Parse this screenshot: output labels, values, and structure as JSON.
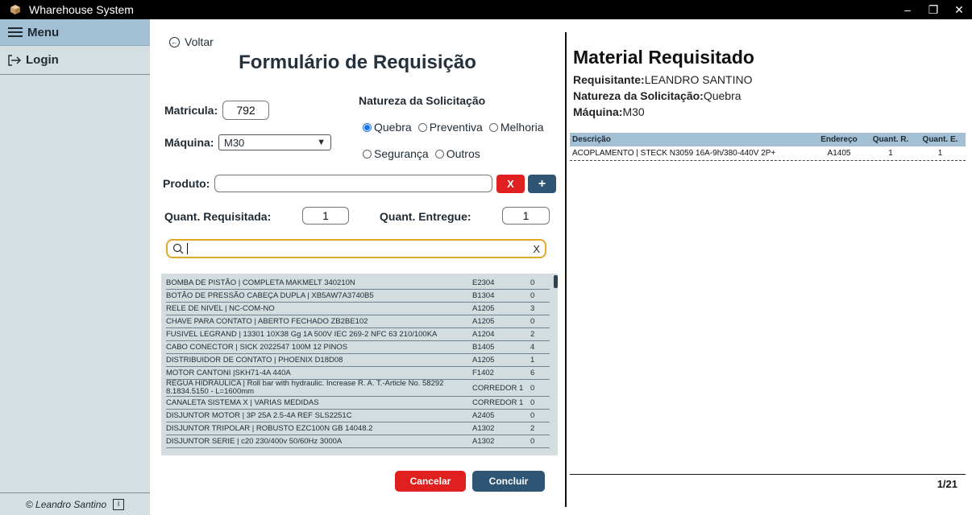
{
  "window": {
    "title": "Wharehouse System",
    "minimize": "–",
    "restore": "❐",
    "close": "✕"
  },
  "sidebar": {
    "menu_label": "Menu",
    "login_label": "Login",
    "footer": "© Leandro Santino",
    "info_glyph": "i"
  },
  "form": {
    "back_label": "Voltar",
    "title": "Formulário de Requisição",
    "matricula_label": "Matricula:",
    "matricula_value": "792",
    "natureza_label": "Natureza da Solicitação",
    "maquina_label": "Máquina:",
    "maquina_value": "M30",
    "natureza_options": [
      {
        "label": "Quebra",
        "selected": true
      },
      {
        "label": "Preventiva",
        "selected": false
      },
      {
        "label": "Melhoria",
        "selected": false
      },
      {
        "label": "Segurança",
        "selected": false
      },
      {
        "label": "Outros",
        "selected": false
      }
    ],
    "produto_label": "Produto:",
    "produto_value": "",
    "clear_button": "X",
    "add_button": "+",
    "quant_req_label": "Quant. Requisitada:",
    "quant_req_value": "1",
    "quant_ent_label": "Quant. Entregue:",
    "quant_ent_value": "1",
    "search_value": "",
    "search_clear": "X",
    "cancel_label": "Cancelar",
    "confirm_label": "Concluir"
  },
  "product_list": [
    {
      "desc": "BOMBA DE PISTÃO | COMPLETA MAKMELT 340210N",
      "end": "E2304",
      "qty": "0"
    },
    {
      "desc": "BOTÃO DE PRESSÃO CABEÇA DUPLA | XB5AW7A3740B5",
      "end": "B1304",
      "qty": "0"
    },
    {
      "desc": "RELE DE NIVEL | NC-COM-NO",
      "end": "A1205",
      "qty": "3"
    },
    {
      "desc": "CHAVE PARA CONTATO | ABERTO FECHADO ZB2BE102",
      "end": "A1205",
      "qty": "0"
    },
    {
      "desc": "FUSIVEL LEGRAND | 13301 10X38 Gg 1A 500V IEC 269-2 NFC 63 210/100KA",
      "end": "A1204",
      "qty": "2"
    },
    {
      "desc": "CABO CONECTOR | SICK 2022547 100M 12 PINOS",
      "end": "B1405",
      "qty": "4"
    },
    {
      "desc": "DISTRIBUIDOR DE CONTATO | PHOENIX D18D08",
      "end": "A1205",
      "qty": "1"
    },
    {
      "desc": "MOTOR CANTONI |SKH71-4A 440A",
      "end": "F1402",
      "qty": "6"
    },
    {
      "desc": "REGUA HIDRAULICA | Roll bar with hydraulic. Increase R. A. T.-Article No. 58292 8.1834.5150 - L=1600mm",
      "end": "CORREDOR 1",
      "qty": "0"
    },
    {
      "desc": "CANALETA SISTEMA X | VARIAS MEDIDAS",
      "end": "CORREDOR 1",
      "qty": "0"
    },
    {
      "desc": "DISJUNTOR MOTOR | 3P 25A 2.5-4A REF SLS2251C",
      "end": "A2405",
      "qty": "0"
    },
    {
      "desc": "DISJUNTOR TRIPOLAR | ROBUSTO EZC100N GB 14048.2",
      "end": "A1302",
      "qty": "2"
    },
    {
      "desc": "DISJUNTOR SERIE | c20 230/400v 50/60Hz 3000A",
      "end": "A1302",
      "qty": "0"
    }
  ],
  "panel": {
    "title": "Material Requisitado",
    "requisitante_label": "Requisitante:",
    "requisitante_value": "LEANDRO SANTINO",
    "natureza_label": "Natureza da Solicitação:",
    "natureza_value": "Quebra",
    "maquina_label": "Máquina:",
    "maquina_value": "M30",
    "columns": [
      "Descrição",
      "Endereço",
      "Quant. R.",
      "Quant. E."
    ],
    "rows": [
      {
        "desc": "ACOPLAMENTO | STECK N3059 16A-9h/380-440V 2P+",
        "end": "A1405",
        "qr": "1",
        "qe": "1"
      }
    ],
    "page": "1/21"
  }
}
